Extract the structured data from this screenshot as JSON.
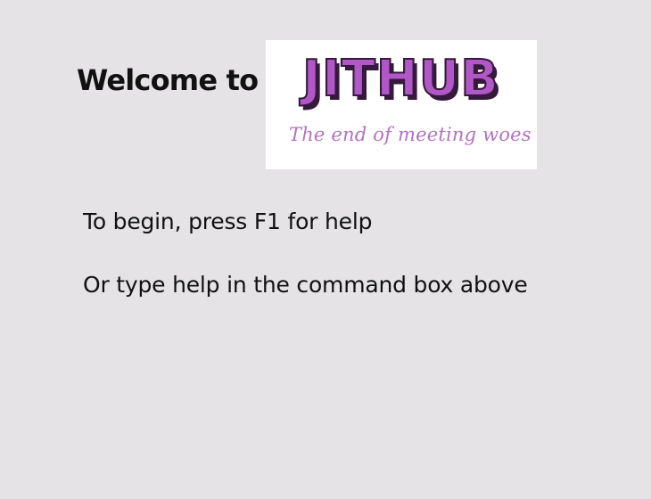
{
  "welcome": {
    "text": "Welcome to"
  },
  "logo": {
    "word": "JITHUB",
    "tagline": "The end of meeting woes",
    "colors": {
      "fill": "#b157c8",
      "outline": "#351b3b",
      "tagline": "#b470c2"
    }
  },
  "instructions": {
    "line1": "To begin, press F1 for help",
    "line2": "Or type help in the command box above"
  },
  "theme": {
    "background": "#e5e3e6",
    "text": "#111111",
    "logo_background": "#ffffff"
  }
}
